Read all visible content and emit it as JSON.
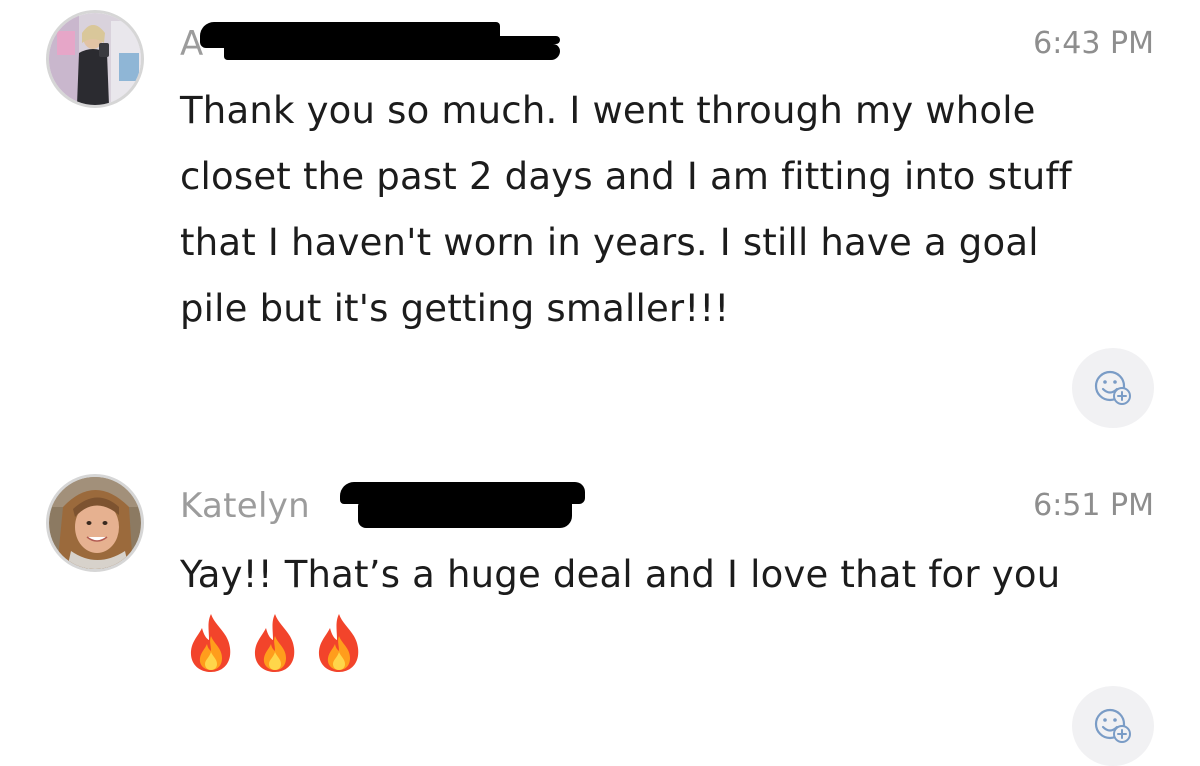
{
  "conversation": {
    "messages": [
      {
        "sender_prefix": "A",
        "time": "6:43 PM",
        "text": "Thank you so much. I went through my whole\ncloset the past 2 days and I am fitting into stuff\nthat I haven't worn in years. I still have a goal\npile but it's getting smaller!!!",
        "add_reaction_icon": "emoji-add-icon"
      },
      {
        "sender_prefix": "Katelyn",
        "time": "6:51 PM",
        "text": "Yay!! That’s a huge deal and I love that for you",
        "emojis": [
          "fire-icon",
          "fire-icon",
          "fire-icon"
        ],
        "add_reaction_icon": "emoji-add-icon"
      }
    ]
  },
  "colors": {
    "sender_name": "#9c9c9c",
    "timestamp": "#8e8e8e",
    "body_text": "#1c1c1c",
    "redaction": "#000000",
    "reaction_button_bg": "#f1f1f3",
    "reaction_icon": "#7a9cc6"
  }
}
